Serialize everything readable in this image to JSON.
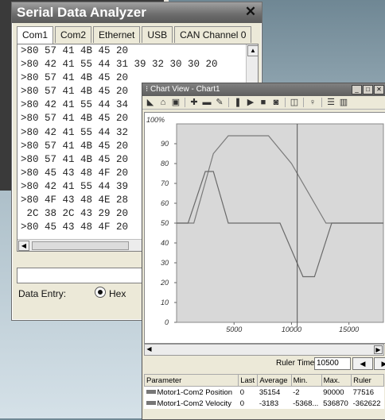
{
  "serial": {
    "title": "Serial Data Analyzer",
    "tabs": [
      "Com1",
      "Com2",
      "Ethernet",
      "USB",
      "CAN Channel 0"
    ],
    "lines": [
      ">80 57 41 4B 45 20",
      ">80 42 41 55 44 31 39 32 30 30 20",
      ">80 57 41 4B 45 20",
      ">80 57 41 4B 45 20",
      ">80 42 41 55 44 34",
      ">80 57 41 4B 45 20",
      ">80 42 41 55 44 32",
      ">80 57 41 4B 45 20",
      ">80 57 41 4B 45 20",
      ">80 45 43 48 4F 20",
      ">80 42 41 55 44 39",
      ">80 4F 43 48 4E 28",
      " 2C 38 2C 43 29 20",
      ">80 45 43 48 4F 20"
    ],
    "data_entry_label": "Data Entry:",
    "hex_label": "Hex"
  },
  "chart": {
    "title": "Chart View - Chart1",
    "ruler_label": "Ruler Time:",
    "ruler_value": "10500",
    "legend_headers": [
      "Parameter",
      "Last",
      "Average",
      "Min.",
      "Max.",
      "Ruler"
    ],
    "legend_rows": [
      [
        "Motor1-Com2 Position",
        "0",
        "35154",
        "-2",
        "90000",
        "77516"
      ],
      [
        "Motor1-Com2 Velocity",
        "0",
        "-3183",
        "-5368...",
        "536870",
        "-362622"
      ]
    ]
  },
  "chart_data": {
    "type": "line",
    "top_label": "100%",
    "y_ticks": [
      "90",
      "80",
      "70",
      "60",
      "50",
      "40",
      "30",
      "20",
      "10",
      "0"
    ],
    "x_ticks": [
      "5000",
      "10000",
      "15000"
    ],
    "xlim": [
      0,
      18000
    ],
    "ylim": [
      0,
      100
    ],
    "ruler_x": 10500,
    "series": [
      {
        "values": [
          [
            0,
            50
          ],
          [
            1500,
            50
          ],
          [
            3200,
            85
          ],
          [
            4500,
            94
          ],
          [
            8000,
            94
          ],
          [
            10000,
            80
          ],
          [
            12000,
            60
          ],
          [
            13000,
            50
          ],
          [
            18000,
            50
          ]
        ]
      },
      {
        "values": [
          [
            0,
            50
          ],
          [
            1000,
            50
          ],
          [
            2500,
            76
          ],
          [
            3200,
            76
          ],
          [
            4500,
            50
          ],
          [
            9000,
            50
          ],
          [
            11000,
            23
          ],
          [
            12000,
            23
          ],
          [
            13500,
            50
          ],
          [
            18000,
            50
          ]
        ]
      }
    ]
  }
}
